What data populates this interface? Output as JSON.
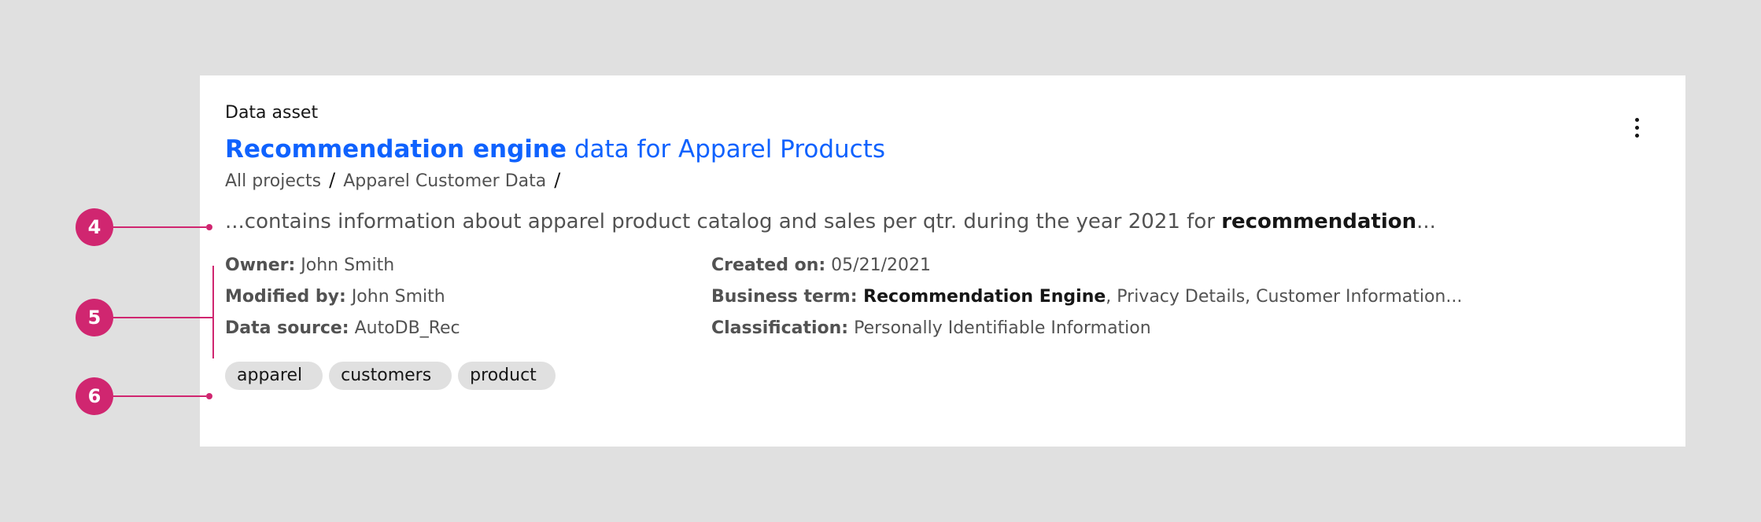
{
  "card": {
    "asset_type": "Data asset",
    "title_bold": "Recommendation engine",
    "title_rest": " data for Apparel Products",
    "breadcrumb": [
      "All projects",
      "Apparel Customer Data"
    ],
    "breadcrumb_sep": "/",
    "description_pre": "...contains information about apparel product catalog and sales per qtr. during the year 2021 for ",
    "description_match": "recommendation",
    "description_post": "...",
    "overflow_icon": "overflow-menu-vertical-icon"
  },
  "metadata": {
    "owner_label": "Owner:",
    "owner_value": " John Smith",
    "modified_label": "Modified by:",
    "modified_value": " John Smith",
    "source_label": "Data source:",
    "source_value": " AutoDB_Rec",
    "created_label": "Created on:",
    "created_value": " 05/21/2021",
    "term_label": "Business term:",
    "term_strong": " Recommendation Engine",
    "term_rest": ", Privacy Details, Customer Information...",
    "class_label": "Classification:",
    "class_value": " Personally Identifiable Information"
  },
  "tags": [
    "apparel",
    "customers",
    "product"
  ],
  "annotations": [
    "4",
    "5",
    "6"
  ],
  "colors": {
    "accent": "#d02670",
    "link": "#0f62fe",
    "background": "#e0e0e0",
    "tag_bg": "#e0e0e0"
  }
}
